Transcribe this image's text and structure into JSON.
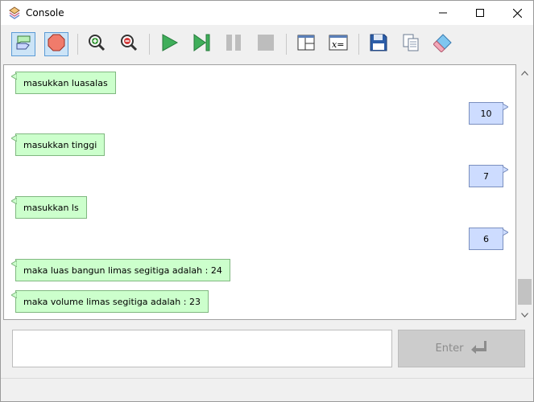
{
  "window": {
    "title": "Console"
  },
  "toolbar": {
    "buttons": [
      {
        "id": "show-console",
        "icon": "console-icon",
        "toggled": true
      },
      {
        "id": "stop",
        "icon": "stop-octagon-icon",
        "toggled": true
      },
      {
        "id": "zoom-in",
        "icon": "zoom-in-icon"
      },
      {
        "id": "zoom-out",
        "icon": "zoom-out-icon"
      },
      {
        "id": "run",
        "icon": "play-icon"
      },
      {
        "id": "step",
        "icon": "step-icon"
      },
      {
        "id": "pause",
        "icon": "pause-icon"
      },
      {
        "id": "halt",
        "icon": "stop-square-icon"
      },
      {
        "id": "layout",
        "icon": "layout-icon"
      },
      {
        "id": "variables",
        "icon": "variables-icon"
      },
      {
        "id": "save",
        "icon": "save-icon"
      },
      {
        "id": "copy",
        "icon": "copy-icon"
      },
      {
        "id": "clear",
        "icon": "eraser-icon"
      }
    ]
  },
  "console": {
    "messages": [
      {
        "type": "output",
        "text": "masukkan luasalas"
      },
      {
        "type": "input",
        "text": "10"
      },
      {
        "type": "output",
        "text": "masukkan tinggi"
      },
      {
        "type": "input",
        "text": "7"
      },
      {
        "type": "output",
        "text": "masukkan ls"
      },
      {
        "type": "input",
        "text": "6"
      },
      {
        "type": "output",
        "text": "maka luas bangun limas segitiga adalah : 24"
      },
      {
        "type": "output",
        "text": "maka volume limas segitiga adalah : 23"
      }
    ]
  },
  "input": {
    "value": "",
    "placeholder": ""
  },
  "enter_button": {
    "label": "Enter",
    "icon": "enter-arrow-icon"
  },
  "colors": {
    "output_bubble": "#ccffcc",
    "input_bubble": "#cddcff",
    "toggled_button": "#cce4f7"
  }
}
